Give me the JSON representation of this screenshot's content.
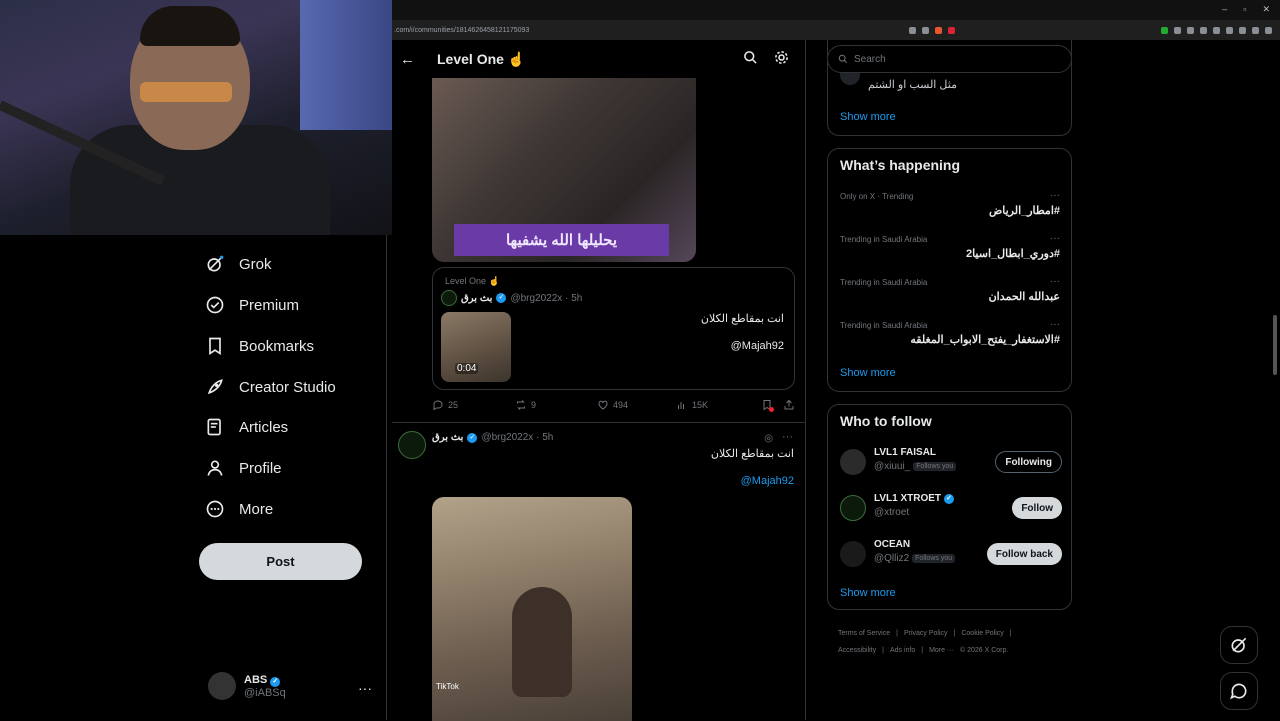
{
  "browser": {
    "url": ".com/i/communities/1814626458121175093",
    "window_controls": [
      "–",
      "▫",
      "✕"
    ]
  },
  "nav": {
    "items": [
      {
        "label": "Grok",
        "icon": "grok-icon"
      },
      {
        "label": "Premium",
        "icon": "premium-icon"
      },
      {
        "label": "Bookmarks",
        "icon": "bookmark-icon"
      },
      {
        "label": "Creator Studio",
        "icon": "rocket-icon"
      },
      {
        "label": "Articles",
        "icon": "article-icon"
      },
      {
        "label": "Profile",
        "icon": "profile-icon"
      },
      {
        "label": "More",
        "icon": "more-circle-icon"
      }
    ],
    "post_label": "Post"
  },
  "account": {
    "name": "ABS",
    "handle": "@iABSq",
    "more": "···"
  },
  "feed": {
    "title": "Level One ☝",
    "image_caption": "يحليلها الله يشفيها",
    "quote": {
      "community": "Level One ☝",
      "author": "بث برق",
      "handle_time": "@brg2022x · 5h",
      "text": "انت بمقاطع الكلان",
      "mention": "@Majah92",
      "duration": "0:04"
    },
    "actions": {
      "replies": "25",
      "reposts": "9",
      "likes": "494",
      "views": "15K"
    },
    "post2": {
      "author": "بث برق",
      "handle_time": "@brg2022x · 5h",
      "text": "انت بمقاطع الكلان",
      "mention": "@Majah92",
      "watermark": "TikTok",
      "more": "···"
    }
  },
  "right": {
    "search_placeholder": "Search",
    "top_card": {
      "text": "مثل السب او الشتم",
      "show_more": "Show more"
    },
    "happening": {
      "title": "What’s happening",
      "trends": [
        {
          "meta": "Only on X · Trending",
          "tag": "#امطار_الرياض"
        },
        {
          "meta": "Trending in Saudi Arabia",
          "tag": "#دوري_ابطال_اسيا2"
        },
        {
          "meta": "Trending in Saudi Arabia",
          "tag": "عبدالله الحمدان"
        },
        {
          "meta": "Trending in Saudi Arabia",
          "tag": "#الاستغفار_يفتح_الابواب_المغلقه"
        }
      ],
      "more_dots": "···",
      "show_more": "Show more"
    },
    "who_to_follow": {
      "title": "Who to follow",
      "users": [
        {
          "name": "LVL1 FAISAL",
          "handle": "@xiuui_",
          "follows_you": "Follows you",
          "button": "Following",
          "verified": false
        },
        {
          "name": "LVL1 XTROET",
          "handle": "@xtroet",
          "follows_you": "",
          "button": "Follow",
          "verified": true
        },
        {
          "name": "OCEAN",
          "handle": "@Qlliz2",
          "follows_you": "Follows you",
          "button": "Follow back",
          "verified": false
        }
      ],
      "show_more": "Show more"
    },
    "footer": [
      "Terms of Service",
      "|",
      "Privacy Policy",
      "|",
      "Cookie Policy",
      "|",
      "Accessibility",
      "|",
      "Ads info",
      "|",
      "More ···",
      "© 2026 X Corp."
    ]
  },
  "colors": {
    "accent": "#1d9bf0",
    "background": "#000000",
    "border": "#2f3336",
    "muted": "#71767b"
  }
}
